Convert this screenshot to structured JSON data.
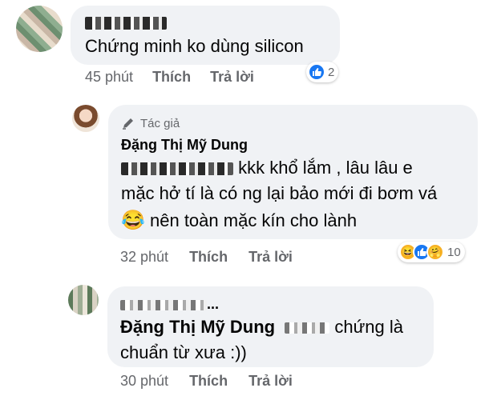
{
  "comments": [
    {
      "author_name": "",
      "text": "Chứng minh ko dùng silicon",
      "time": "45 phút",
      "like_label": "Thích",
      "reply_label": "Trả lời",
      "reaction_count": "2",
      "reactions": [
        "like-icon"
      ]
    },
    {
      "author_tag": "Tác giả",
      "author_name": "Đặng Thị Mỹ Dung",
      "line1_suffix": " kkk khổ lắm , lâu lâu e",
      "line2": "mặc hở tí là có ng lại bảo mới đi bơm vá",
      "line3": " nên toàn mặc kín cho lành",
      "time": "32 phút",
      "like_label": "Thích",
      "reply_label": "Trả lời",
      "reaction_count": "10",
      "reactions": [
        "haha-icon",
        "like-icon",
        "care-icon"
      ]
    },
    {
      "author_name": "...",
      "mention": "Đặng Thị Mỹ Dung",
      "line1_suffix": " chứng là",
      "line2": "chuẩn từ xưa :))",
      "time": "30 phút",
      "like_label": "Thích",
      "reply_label": "Trả lời"
    }
  ],
  "colors": {
    "bubble": "#f0f2f5",
    "meta_text": "#65676b",
    "like_blue": "#1877f2",
    "haha_yellow": "#f7b125"
  }
}
